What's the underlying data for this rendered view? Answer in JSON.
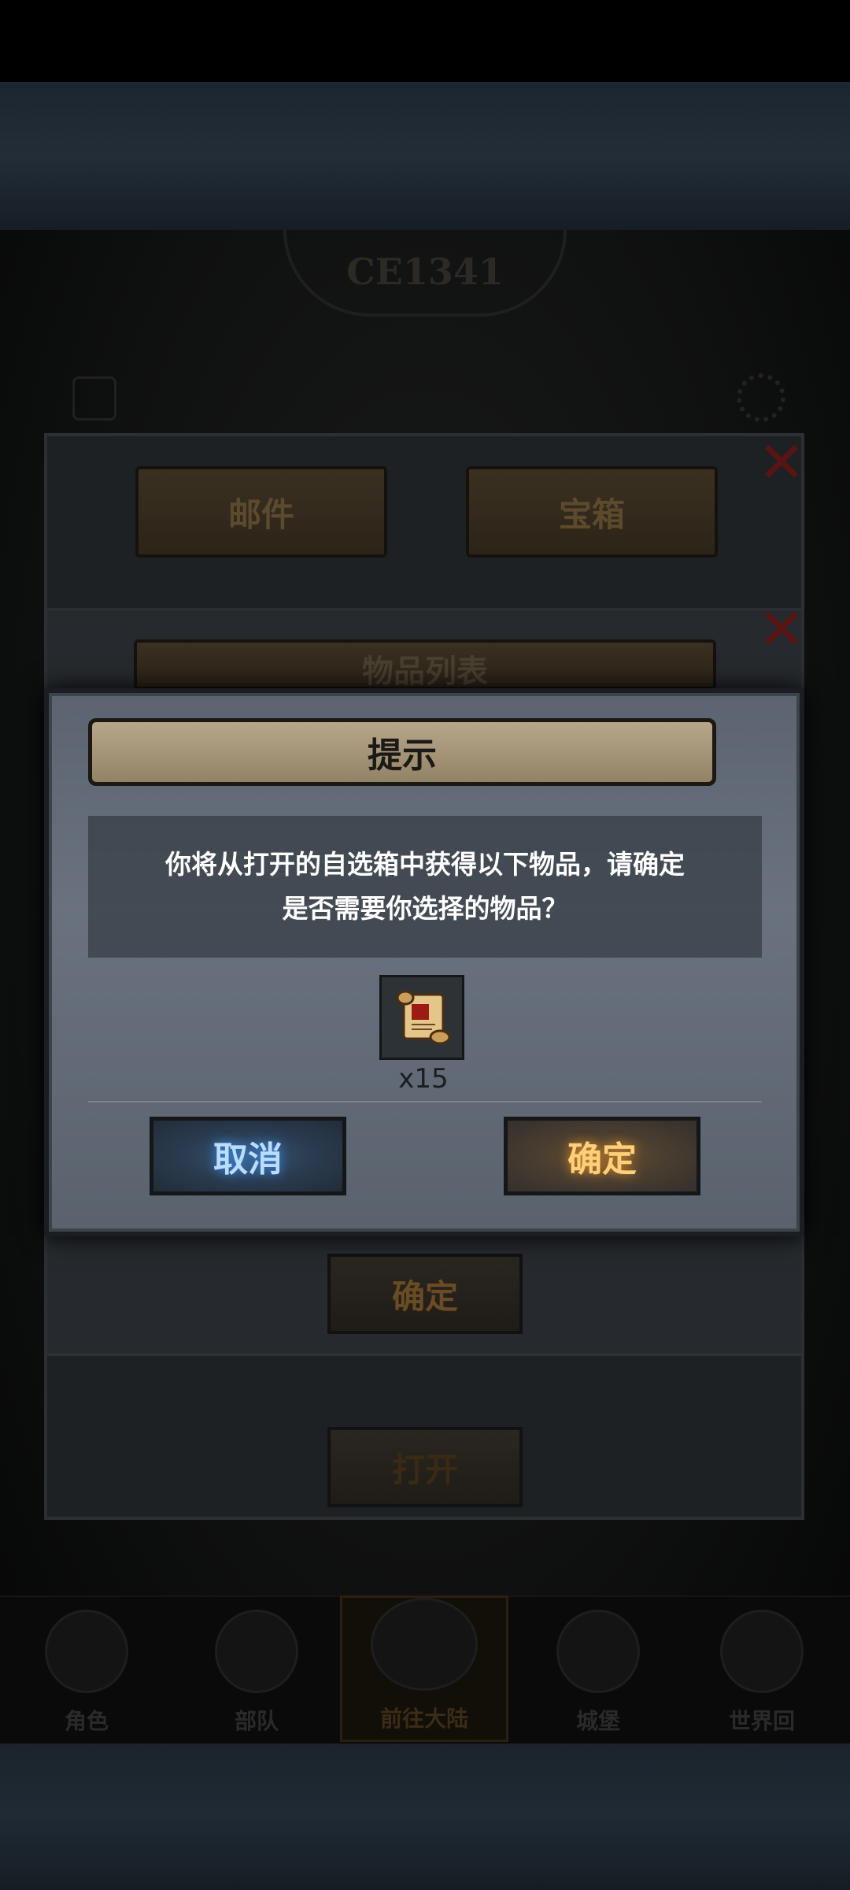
{
  "background": {
    "server_label": "CE1341"
  },
  "behind_panels": {
    "tabs": [
      "邮件",
      "宝箱"
    ],
    "subpanel_title": "物品列表",
    "confirm_label": "确定",
    "open_label": "打开"
  },
  "bottom_nav": [
    "角色",
    "部队",
    "前往大陆",
    "城堡",
    "世界回"
  ],
  "dialog": {
    "title": "提示",
    "message": "你将从打开的自选箱中获得以下物品，请确定\n是否需要你选择的物品？",
    "item": {
      "icon": "scroll-icon",
      "quantity": "x15"
    },
    "cancel_label": "取消",
    "confirm_label": "确定"
  },
  "colors": {
    "cancel_glow": "#3b8de8",
    "confirm_glow": "#d98a2a",
    "title_plate": "#a49377"
  }
}
